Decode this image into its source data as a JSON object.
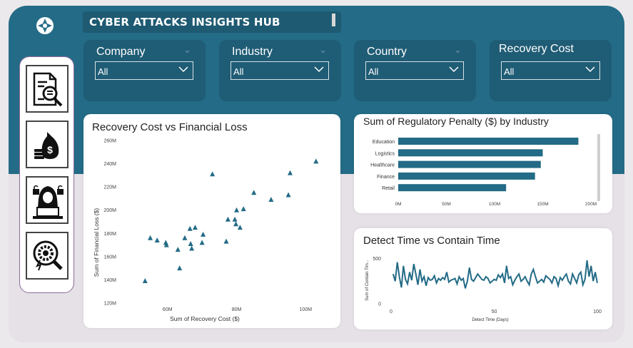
{
  "header": {
    "title": "CYBER ATTACKS INSIGHTS HUB"
  },
  "filters": [
    {
      "label": "Company",
      "value": "All"
    },
    {
      "label": "Industry",
      "value": "All"
    },
    {
      "label": "Country",
      "value": "All"
    },
    {
      "label": "Recovery Cost",
      "value": "All"
    }
  ],
  "nav": {
    "items": [
      "report-search-icon",
      "money-bags-icon",
      "hacker-icon",
      "gear-search-icon"
    ]
  },
  "colors": {
    "primary": "#236b86",
    "panel": "#1f5c75",
    "mark": "#236b86",
    "background": "#ece9ec"
  },
  "chart_data": [
    {
      "type": "scatter",
      "title": "Recovery Cost vs Financial Loss",
      "xlabel": "Sum of Recovery Cost ($)",
      "ylabel": "Sum of Financial Loss ($)",
      "xlim": [
        46,
        108
      ],
      "ylim": [
        120,
        260
      ],
      "x_ticks": [
        60,
        80,
        100
      ],
      "x_tick_labels": [
        "60M",
        "80M",
        "100M"
      ],
      "y_ticks": [
        120,
        140,
        160,
        180,
        200,
        220,
        240,
        260
      ],
      "y_tick_labels": [
        "120M",
        "140M",
        "160M",
        "180M",
        "200M",
        "220M",
        "240M",
        "260M"
      ],
      "points": [
        [
          53.5,
          139
        ],
        [
          55,
          176
        ],
        [
          57,
          174
        ],
        [
          59.5,
          172
        ],
        [
          59.7,
          170
        ],
        [
          63,
          166
        ],
        [
          63.5,
          150
        ],
        [
          65,
          176
        ],
        [
          66.5,
          184
        ],
        [
          66.7,
          171
        ],
        [
          67,
          167
        ],
        [
          68,
          185
        ],
        [
          70,
          172
        ],
        [
          70.3,
          179
        ],
        [
          73,
          231
        ],
        [
          77,
          173
        ],
        [
          77.5,
          192
        ],
        [
          79.5,
          192
        ],
        [
          79.8,
          188
        ],
        [
          80,
          200
        ],
        [
          81,
          185
        ],
        [
          82,
          201
        ],
        [
          85,
          215
        ],
        [
          90,
          209
        ],
        [
          95,
          213
        ],
        [
          95.5,
          232
        ],
        [
          103,
          242
        ]
      ]
    },
    {
      "type": "bar",
      "orientation": "horizontal",
      "title": "Sum of Regulatory Penalty ($) by Industry",
      "categories": [
        "Education",
        "Logistics",
        "Healthcare",
        "Finance",
        "Retail"
      ],
      "values": [
        187,
        150,
        148,
        142,
        112
      ],
      "xlim": [
        0,
        200
      ],
      "x_ticks": [
        0,
        50,
        100,
        150,
        200
      ],
      "x_tick_labels": [
        "0M",
        "50M",
        "100M",
        "150M",
        "200M"
      ]
    },
    {
      "type": "line",
      "title": "Detect Time vs Contain Time",
      "xlabel": "Detect Time (Days)",
      "ylabel": "Sum of Contain Tim...",
      "xlim": [
        0,
        100
      ],
      "ylim": [
        0,
        560
      ],
      "x_ticks": [
        0,
        50,
        100
      ],
      "x_tick_labels": [
        "0",
        "50",
        "100"
      ],
      "y_ticks": [
        0,
        500
      ],
      "y_tick_labels": [
        "0",
        "500"
      ],
      "x": [
        1,
        2,
        3,
        4,
        5,
        6,
        7,
        8,
        9,
        10,
        11,
        12,
        13,
        14,
        15,
        16,
        17,
        18,
        19,
        20,
        21,
        22,
        23,
        24,
        25,
        26,
        27,
        28,
        29,
        30,
        31,
        32,
        33,
        34,
        35,
        36,
        37,
        38,
        39,
        40,
        41,
        42,
        43,
        44,
        45,
        46,
        47,
        48,
        49,
        50,
        51,
        52,
        53,
        54,
        55,
        56,
        57,
        58,
        59,
        60,
        61,
        62,
        63,
        64,
        65,
        66,
        67,
        68,
        69,
        70,
        71,
        72,
        73,
        74,
        75,
        76,
        77,
        78,
        79,
        80,
        81,
        82,
        83,
        84,
        85,
        86,
        87,
        88,
        89,
        90,
        91,
        92,
        93,
        94,
        95,
        96,
        97,
        98,
        99,
        100
      ],
      "y": [
        330,
        250,
        460,
        300,
        180,
        420,
        270,
        220,
        350,
        260,
        440,
        330,
        210,
        380,
        250,
        300,
        200,
        290,
        260,
        270,
        310,
        230,
        280,
        260,
        290,
        270,
        350,
        240,
        260,
        270,
        280,
        220,
        300,
        260,
        280,
        170,
        250,
        400,
        270,
        250,
        290,
        330,
        300,
        270,
        260,
        300,
        280,
        230,
        250,
        270,
        260,
        320,
        290,
        330,
        230,
        420,
        280,
        300,
        210,
        260,
        300,
        330,
        250,
        270,
        300,
        250,
        210,
        330,
        380,
        300,
        230,
        250,
        270,
        240,
        310,
        290,
        270,
        230,
        300,
        280,
        200,
        290,
        260,
        300,
        330,
        250,
        220,
        330,
        280,
        230,
        320,
        350,
        210,
        270,
        480,
        300,
        420,
        250,
        350,
        230
      ]
    }
  ]
}
